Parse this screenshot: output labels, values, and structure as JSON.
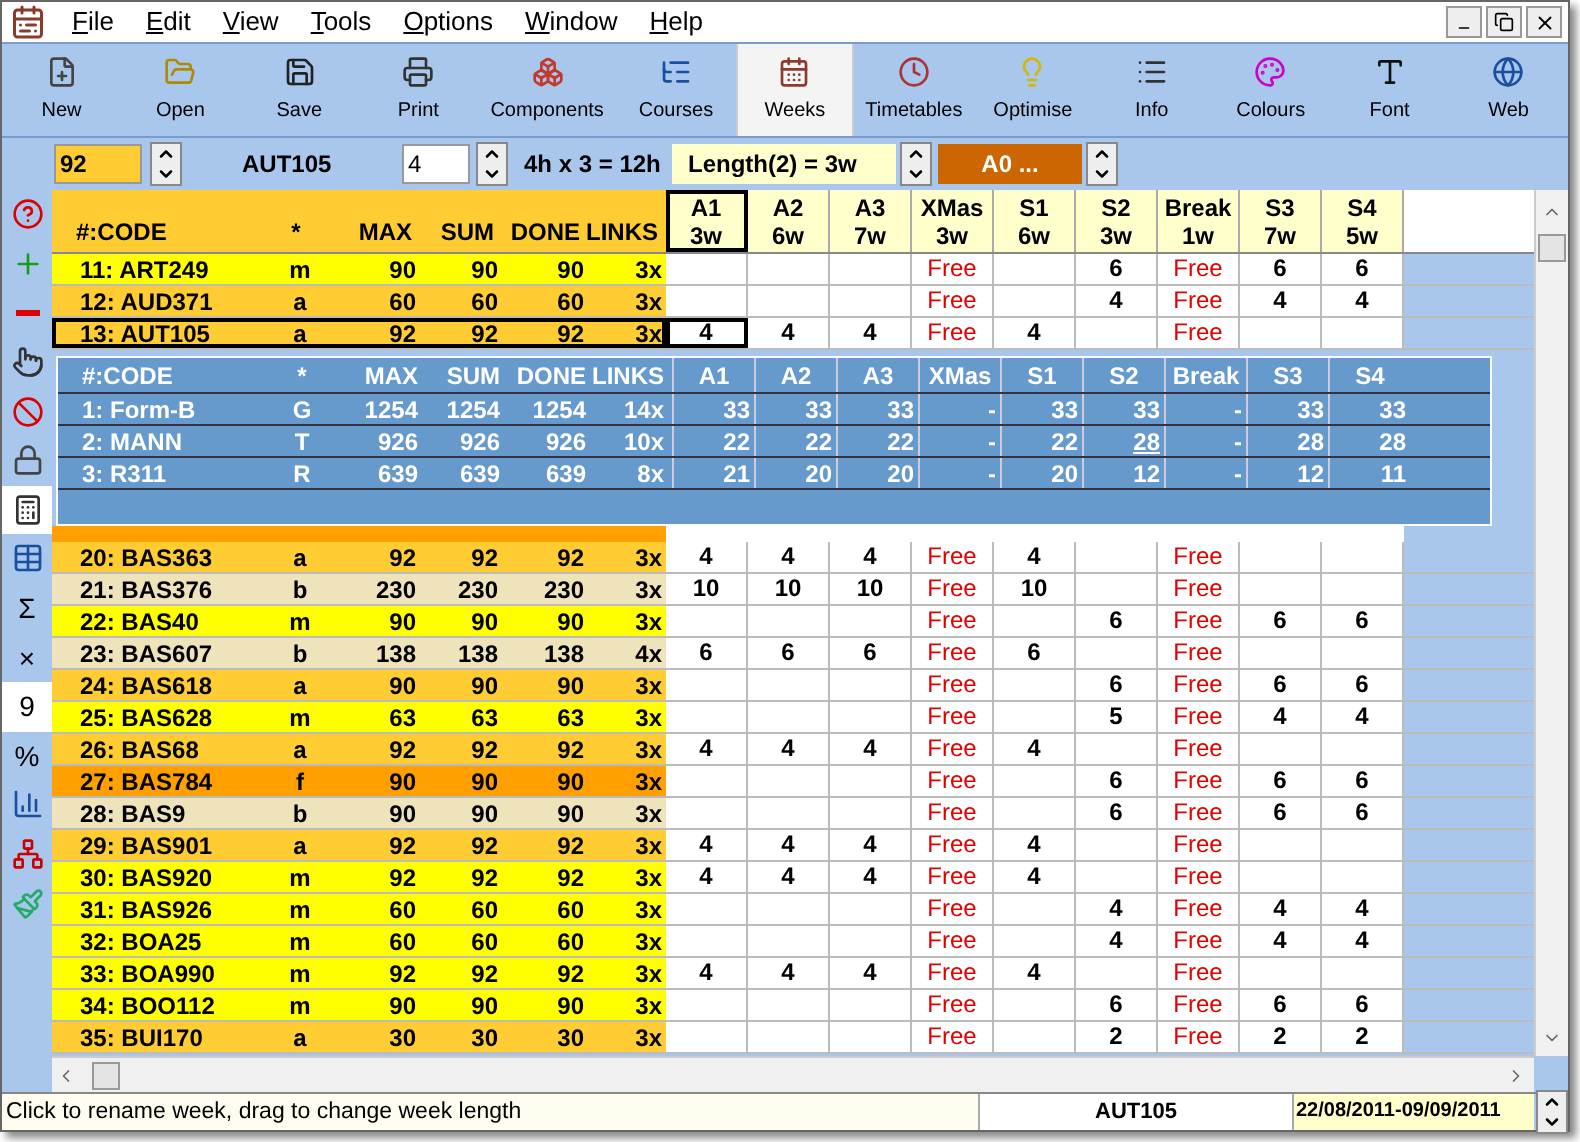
{
  "menu": [
    "File",
    "Edit",
    "View",
    "Tools",
    "Options",
    "Window",
    "Help"
  ],
  "toolbar": [
    {
      "label": "New",
      "selected": false
    },
    {
      "label": "Open",
      "selected": false
    },
    {
      "label": "Save",
      "selected": false
    },
    {
      "label": "Print",
      "selected": false
    },
    {
      "label": "Components",
      "selected": false
    },
    {
      "label": "Courses",
      "selected": false
    },
    {
      "label": "Weeks",
      "selected": true
    },
    {
      "label": "Timetables",
      "selected": false
    },
    {
      "label": "Optimise",
      "selected": false
    },
    {
      "label": "Info",
      "selected": false
    },
    {
      "label": "Colours",
      "selected": false
    },
    {
      "label": "Font",
      "selected": false
    },
    {
      "label": "Web",
      "selected": false
    }
  ],
  "info_bar": {
    "number": "92",
    "code": "AUT105",
    "hours": "4",
    "formula": "4h x 3 = 12h",
    "length": "Length(2) = 3w",
    "option": "A0 ..."
  },
  "sidebar": [
    {
      "kind": "icon",
      "selected": false
    },
    {
      "kind": "icon",
      "selected": false
    },
    {
      "kind": "icon",
      "selected": false
    },
    {
      "kind": "icon",
      "selected": false
    },
    {
      "kind": "icon",
      "selected": false
    },
    {
      "kind": "icon",
      "selected": false
    },
    {
      "kind": "icon",
      "selected": true
    },
    {
      "kind": "icon",
      "selected": false
    },
    {
      "kind": "text",
      "text": "Σ",
      "selected": false
    },
    {
      "kind": "text",
      "text": "×",
      "selected": false
    },
    {
      "kind": "text",
      "text": "9",
      "selected": true
    },
    {
      "kind": "text",
      "text": "%",
      "selected": false
    },
    {
      "kind": "icon",
      "selected": false
    },
    {
      "kind": "icon",
      "selected": false
    },
    {
      "kind": "icon",
      "selected": false
    }
  ],
  "table": {
    "columns": [
      "#:CODE",
      "*",
      "MAX",
      "SUM",
      "DONE",
      "LINKS"
    ],
    "weeks": [
      {
        "name": "A1",
        "length": "3w",
        "kind": "term",
        "selected": true
      },
      {
        "name": "A2",
        "length": "6w",
        "kind": "term",
        "selected": false
      },
      {
        "name": "A3",
        "length": "7w",
        "kind": "term",
        "selected": false
      },
      {
        "name": "XMas",
        "length": "3w",
        "kind": "holiday",
        "selected": false
      },
      {
        "name": "S1",
        "length": "6w",
        "kind": "term",
        "selected": false
      },
      {
        "name": "S2",
        "length": "3w",
        "kind": "term",
        "selected": false
      },
      {
        "name": "Break",
        "length": "1w",
        "kind": "holiday",
        "selected": false
      },
      {
        "name": "S3",
        "length": "7w",
        "kind": "term",
        "selected": false
      },
      {
        "name": "S4",
        "length": "5w",
        "kind": "term",
        "selected": false
      }
    ],
    "rows_top": [
      {
        "code": "11: ART249",
        "type": "m",
        "max": "90",
        "sum": "90",
        "done": "90",
        "links": "3x",
        "color": "#ffff00",
        "selected": false,
        "weeks": {
          "XMas": "Free",
          "S2": "6",
          "Break": "Free",
          "S3": "6",
          "S4": "6"
        }
      },
      {
        "code": "12: AUD371",
        "type": "a",
        "max": "60",
        "sum": "60",
        "done": "60",
        "links": "3x",
        "color": "#ffcc33",
        "selected": false,
        "weeks": {
          "XMas": "Free",
          "S2": "4",
          "Break": "Free",
          "S3": "4",
          "S4": "4"
        }
      },
      {
        "code": "13: AUT105",
        "type": "a",
        "max": "92",
        "sum": "92",
        "done": "92",
        "links": "3x",
        "color": "#ffcc33",
        "selected": true,
        "weeks": {
          "A1": "4",
          "A2": "4",
          "A3": "4",
          "XMas": "Free",
          "S1": "4",
          "Break": "Free"
        }
      }
    ],
    "rows_bottom": [
      {
        "code": "20: BAS363",
        "type": "a",
        "max": "92",
        "sum": "92",
        "done": "92",
        "links": "3x",
        "color": "#ffcc33",
        "selected": false,
        "weeks": {
          "A1": "4",
          "A2": "4",
          "A3": "4",
          "XMas": "Free",
          "S1": "4",
          "Break": "Free"
        }
      },
      {
        "code": "21: BAS376",
        "type": "b",
        "max": "230",
        "sum": "230",
        "done": "230",
        "links": "3x",
        "color": "#eee3bb",
        "selected": false,
        "weeks": {
          "A1": "10",
          "A2": "10",
          "A3": "10",
          "XMas": "Free",
          "S1": "10",
          "Break": "Free"
        }
      },
      {
        "code": "22: BAS40",
        "type": "m",
        "max": "90",
        "sum": "90",
        "done": "90",
        "links": "3x",
        "color": "#ffff00",
        "selected": false,
        "weeks": {
          "XMas": "Free",
          "S2": "6",
          "Break": "Free",
          "S3": "6",
          "S4": "6"
        }
      },
      {
        "code": "23: BAS607",
        "type": "b",
        "max": "138",
        "sum": "138",
        "done": "138",
        "links": "4x",
        "color": "#eee3bb",
        "selected": false,
        "weeks": {
          "A1": "6",
          "A2": "6",
          "A3": "6",
          "XMas": "Free",
          "S1": "6",
          "Break": "Free"
        }
      },
      {
        "code": "24: BAS618",
        "type": "a",
        "max": "90",
        "sum": "90",
        "done": "90",
        "links": "3x",
        "color": "#ffcc33",
        "selected": false,
        "weeks": {
          "XMas": "Free",
          "S2": "6",
          "Break": "Free",
          "S3": "6",
          "S4": "6"
        }
      },
      {
        "code": "25: BAS628",
        "type": "m",
        "max": "63",
        "sum": "63",
        "done": "63",
        "links": "3x",
        "color": "#ffff00",
        "selected": false,
        "weeks": {
          "XMas": "Free",
          "S2": "5",
          "Break": "Free",
          "S3": "4",
          "S4": "4"
        }
      },
      {
        "code": "26: BAS68",
        "type": "a",
        "max": "92",
        "sum": "92",
        "done": "92",
        "links": "3x",
        "color": "#ffcc33",
        "selected": false,
        "weeks": {
          "A1": "4",
          "A2": "4",
          "A3": "4",
          "XMas": "Free",
          "S1": "4",
          "Break": "Free"
        }
      },
      {
        "code": "27: BAS784",
        "type": "f",
        "max": "90",
        "sum": "90",
        "done": "90",
        "links": "3x",
        "color": "#ff9f00",
        "selected": false,
        "weeks": {
          "XMas": "Free",
          "S2": "6",
          "Break": "Free",
          "S3": "6",
          "S4": "6"
        }
      },
      {
        "code": "28: BAS9",
        "type": "b",
        "max": "90",
        "sum": "90",
        "done": "90",
        "links": "3x",
        "color": "#eee3bb",
        "selected": false,
        "weeks": {
          "XMas": "Free",
          "S2": "6",
          "Break": "Free",
          "S3": "6",
          "S4": "6"
        }
      },
      {
        "code": "29: BAS901",
        "type": "a",
        "max": "92",
        "sum": "92",
        "done": "92",
        "links": "3x",
        "color": "#ffcc33",
        "selected": false,
        "weeks": {
          "A1": "4",
          "A2": "4",
          "A3": "4",
          "XMas": "Free",
          "S1": "4",
          "Break": "Free"
        }
      },
      {
        "code": "30: BAS920",
        "type": "m",
        "max": "92",
        "sum": "92",
        "done": "92",
        "links": "3x",
        "color": "#ffff00",
        "selected": false,
        "weeks": {
          "A1": "4",
          "A2": "4",
          "A3": "4",
          "XMas": "Free",
          "S1": "4",
          "Break": "Free"
        }
      },
      {
        "code": "31: BAS926",
        "type": "m",
        "max": "60",
        "sum": "60",
        "done": "60",
        "links": "3x",
        "color": "#ffff00",
        "selected": false,
        "weeks": {
          "XMas": "Free",
          "S2": "4",
          "Break": "Free",
          "S3": "4",
          "S4": "4"
        }
      },
      {
        "code": "32: BOA25",
        "type": "m",
        "max": "60",
        "sum": "60",
        "done": "60",
        "links": "3x",
        "color": "#ffff00",
        "selected": false,
        "weeks": {
          "XMas": "Free",
          "S2": "4",
          "Break": "Free",
          "S3": "4",
          "S4": "4"
        }
      },
      {
        "code": "33: BOA990",
        "type": "m",
        "max": "92",
        "sum": "92",
        "done": "92",
        "links": "3x",
        "color": "#ffff00",
        "selected": false,
        "weeks": {
          "A1": "4",
          "A2": "4",
          "A3": "4",
          "XMas": "Free",
          "S1": "4",
          "Break": "Free"
        }
      },
      {
        "code": "34: BOO112",
        "type": "m",
        "max": "90",
        "sum": "90",
        "done": "90",
        "links": "3x",
        "color": "#ffff00",
        "selected": false,
        "weeks": {
          "XMas": "Free",
          "S2": "6",
          "Break": "Free",
          "S3": "6",
          "S4": "6"
        }
      },
      {
        "code": "35: BUI170",
        "type": "a",
        "max": "30",
        "sum": "30",
        "done": "30",
        "links": "3x",
        "color": "#ffcc33",
        "selected": false,
        "weeks": {
          "XMas": "Free",
          "S2": "2",
          "Break": "Free",
          "S3": "2",
          "S4": "2"
        }
      }
    ]
  },
  "overlay": {
    "columns": [
      "#:CODE",
      "*",
      "MAX",
      "SUM",
      "DONE",
      "LINKS",
      "A1",
      "A2",
      "A3",
      "XMas",
      "S1",
      "S2",
      "Break",
      "S3",
      "S4"
    ],
    "rows": [
      {
        "code": "1: Form-B",
        "type": "G",
        "max": "1254",
        "sum": "1254",
        "done": "1254",
        "links": "14x",
        "weeks": [
          {
            "text": "33",
            "underlined": false
          },
          {
            "text": "33",
            "underlined": false
          },
          {
            "text": "33",
            "underlined": false
          },
          {
            "text": "-",
            "underlined": false
          },
          {
            "text": "33",
            "underlined": false
          },
          {
            "text": "33",
            "underlined": false
          },
          {
            "text": "-",
            "underlined": false
          },
          {
            "text": "33",
            "underlined": false
          },
          {
            "text": "33",
            "underlined": false
          }
        ]
      },
      {
        "code": "2: MANN",
        "type": "T",
        "max": "926",
        "sum": "926",
        "done": "926",
        "links": "10x",
        "weeks": [
          {
            "text": "22",
            "underlined": false
          },
          {
            "text": "22",
            "underlined": false
          },
          {
            "text": "22",
            "underlined": false
          },
          {
            "text": "-",
            "underlined": false
          },
          {
            "text": "22",
            "underlined": false
          },
          {
            "text": "28",
            "underlined": true
          },
          {
            "text": "-",
            "underlined": false
          },
          {
            "text": "28",
            "underlined": false
          },
          {
            "text": "28",
            "underlined": false
          }
        ]
      },
      {
        "code": "3: R311",
        "type": "R",
        "max": "639",
        "sum": "639",
        "done": "639",
        "links": "8x",
        "weeks": [
          {
            "text": "21",
            "underlined": false
          },
          {
            "text": "20",
            "underlined": false
          },
          {
            "text": "20",
            "underlined": false
          },
          {
            "text": "-",
            "underlined": false
          },
          {
            "text": "20",
            "underlined": false
          },
          {
            "text": "12",
            "underlined": false
          },
          {
            "text": "-",
            "underlined": false
          },
          {
            "text": "12",
            "underlined": false
          },
          {
            "text": "11",
            "underlined": false
          }
        ]
      }
    ]
  },
  "status_bar": {
    "message": "Click to rename week, drag to change week length",
    "code": "AUT105",
    "dates": "22/08/2011-09/09/2011"
  }
}
